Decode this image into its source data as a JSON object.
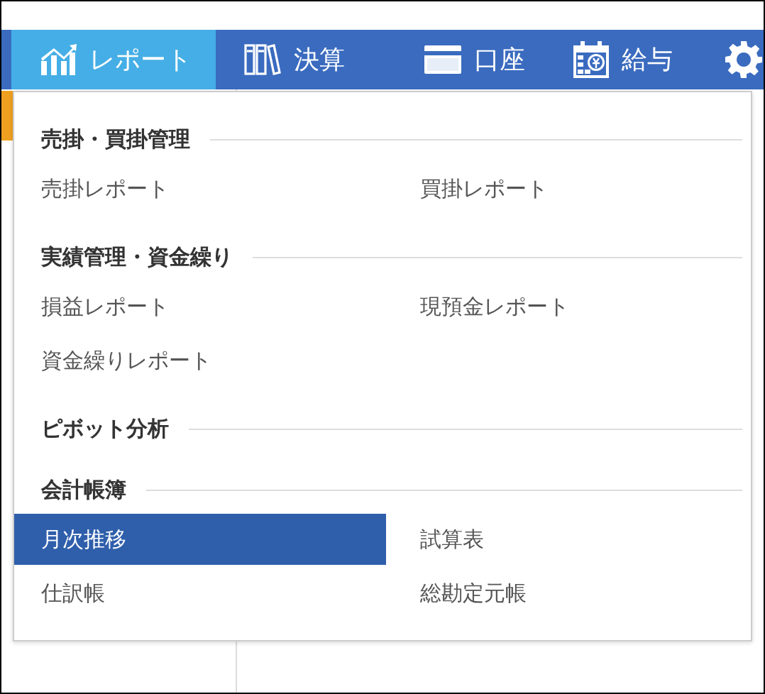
{
  "nav": {
    "tabs": [
      {
        "label": "レポート",
        "kind": "chart",
        "selected": true
      },
      {
        "label": "決算",
        "kind": "binders",
        "selected": false
      },
      {
        "label": "口座",
        "kind": "card",
        "selected": false
      },
      {
        "label": "給与",
        "kind": "calendar",
        "selected": false
      },
      {
        "kind": "gear",
        "selected": false
      }
    ]
  },
  "menu": {
    "sections": [
      {
        "title": "売掛・買掛管理",
        "items": [
          {
            "label": "売掛レポート",
            "selected": false
          },
          {
            "label": "買掛レポート",
            "selected": false
          }
        ]
      },
      {
        "title": "実績管理・資金繰り",
        "items": [
          {
            "label": "損益レポート",
            "selected": false
          },
          {
            "label": "現預金レポート",
            "selected": false
          },
          {
            "label": "資金繰りレポート",
            "selected": false
          }
        ]
      },
      {
        "title": "ピボット分析"
      },
      {
        "title": "会計帳簿",
        "items": [
          {
            "label": "月次推移",
            "selected": true
          },
          {
            "label": "試算表",
            "selected": false
          },
          {
            "label": "仕訳帳",
            "selected": false
          },
          {
            "label": "総勘定元帳",
            "selected": false
          }
        ]
      }
    ]
  }
}
